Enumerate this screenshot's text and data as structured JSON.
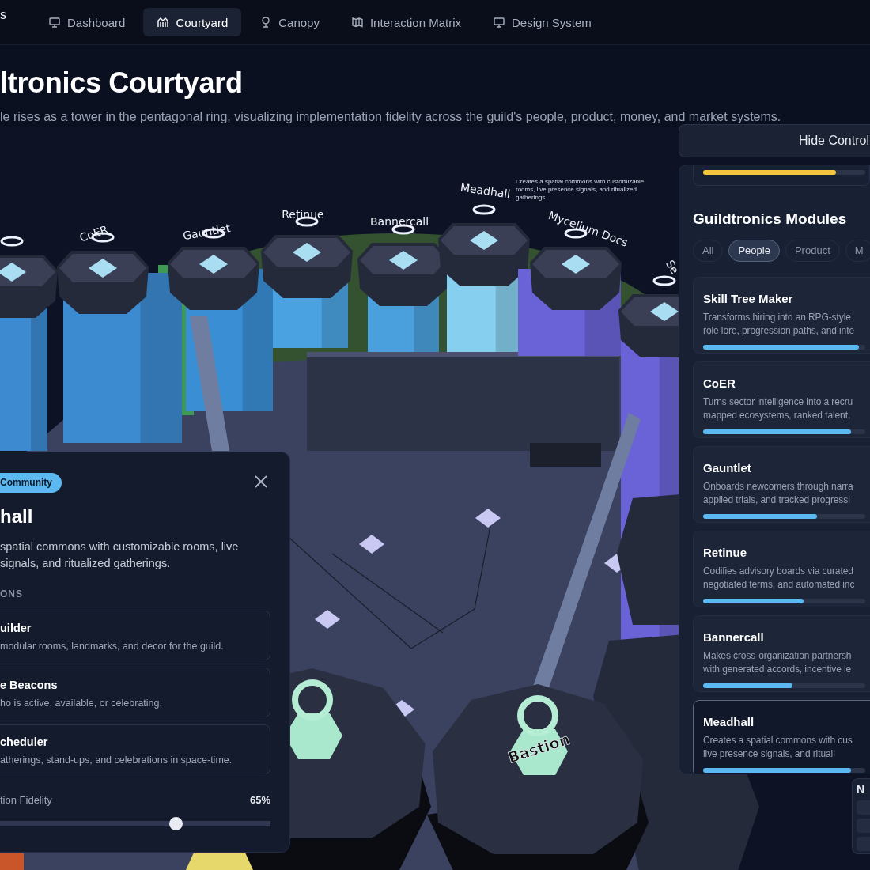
{
  "nav": {
    "brand": "s",
    "tabs": [
      {
        "label": "Dashboard",
        "selected": false
      },
      {
        "label": "Courtyard",
        "selected": true
      },
      {
        "label": "Canopy",
        "selected": false
      },
      {
        "label": "Interaction Matrix",
        "selected": false
      },
      {
        "label": "Design System",
        "selected": false
      }
    ]
  },
  "header": {
    "title": "ltronics Courtyard",
    "subtitle": "le rises as a tower in the pentagonal ring, visualizing implementation fidelity across the guild's people, product, money, and market systems."
  },
  "scene": {
    "tower_labels": [
      "CoER",
      "Gauntlet",
      "Retinue",
      "Bannercall",
      "Meadhall",
      "Mycelium Docs",
      "Se"
    ],
    "tooltip": "Creates a spatial commons with customizable\nrooms, live presence signals, and ritualized\ngatherings",
    "front_labels": [
      "Bastion"
    ]
  },
  "detail": {
    "category": "Community",
    "title": "hall",
    "description": "spatial commons with customizable rooms, live\nsignals, and ritualized gatherings.",
    "section": "ONS",
    "features": [
      {
        "title": "uilder",
        "description": "modular rooms, landmarks, and decor for the guild."
      },
      {
        "title": "e Beacons",
        "description": "ho is active, available, or celebrating."
      },
      {
        "title": "cheduler",
        "description": "atherings, stand-ups, and celebrations in space-time."
      }
    ],
    "fidelity": {
      "label": "tion Fidelity",
      "reading": "65%",
      "level": 0.65
    }
  },
  "controls": {
    "toggle": "Hide Control",
    "partial_card": {
      "level": 0.82
    },
    "title": "Guildtronics Modules",
    "filters": [
      {
        "label": "All",
        "selected": false
      },
      {
        "label": "People",
        "selected": true
      },
      {
        "label": "Product",
        "selected": false
      },
      {
        "label": "M",
        "selected": false
      }
    ],
    "modules": [
      {
        "name": "Skill Tree Maker",
        "description": "Transforms hiring into an RPG-style\nrole lore, progression paths, and inte",
        "level": 0.96,
        "selected": false
      },
      {
        "name": "CoER",
        "description": "Turns sector intelligence into a recru\nmapped ecosystems, ranked talent,",
        "level": 0.91,
        "selected": false
      },
      {
        "name": "Gauntlet",
        "description": "Onboards newcomers through narra\napplied trials, and tracked progressi",
        "level": 0.7,
        "selected": false
      },
      {
        "name": "Retinue",
        "description": "Codifies advisory boards via curated\nnegotiated terms, and automated inc",
        "level": 0.62,
        "selected": false
      },
      {
        "name": "Bannercall",
        "description": "Makes cross-organization partnersh\nwith generated accords, incentive le",
        "level": 0.55,
        "selected": false
      },
      {
        "name": "Meadhall",
        "description": "Creates a spatial commons with cus\nlive presence signals, and rituali",
        "level": 0.91,
        "selected": true
      }
    ]
  },
  "mini_panel": {
    "title": "N"
  }
}
